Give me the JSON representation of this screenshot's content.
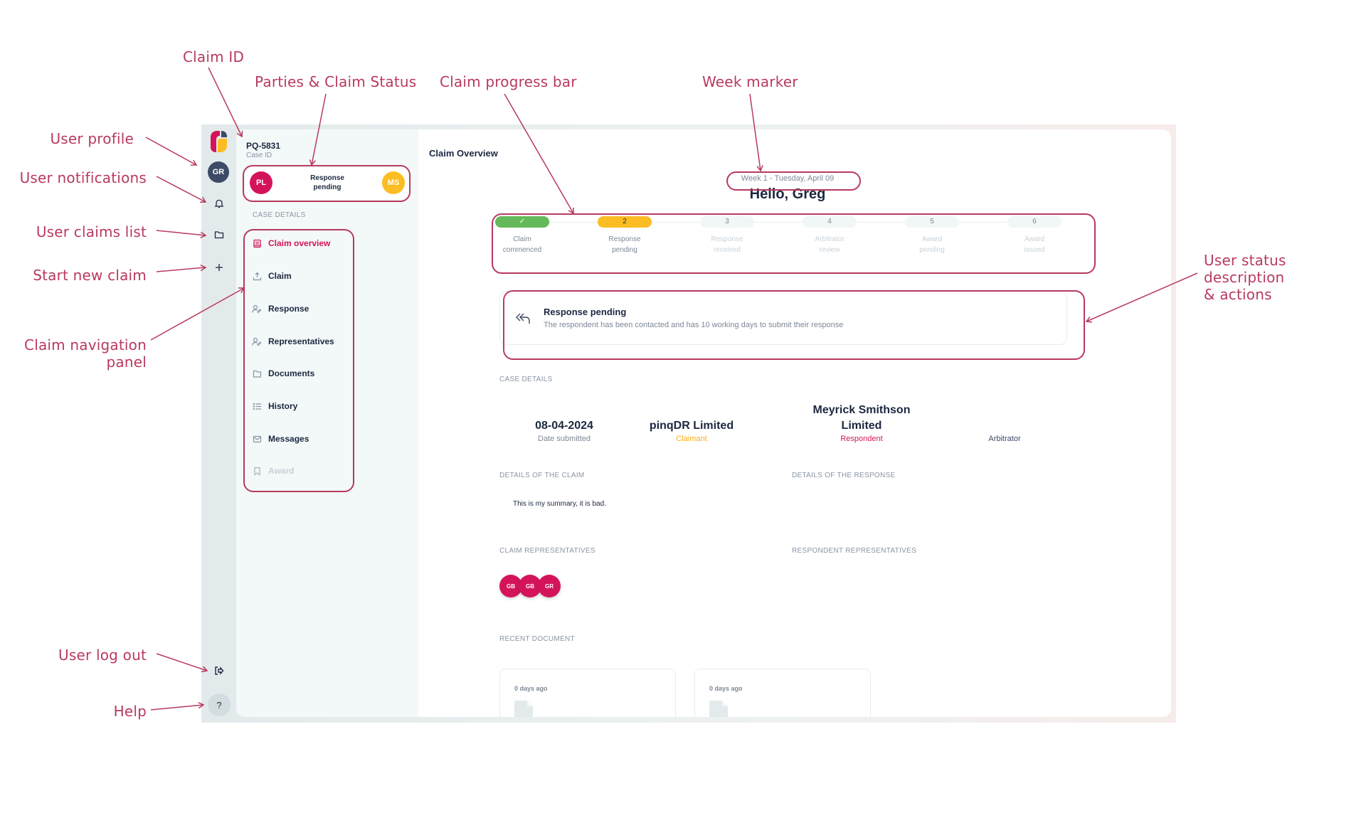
{
  "annotations": {
    "claim_id": "Claim ID",
    "parties_status": "Parties & Claim Status",
    "progress_bar": "Claim progress bar",
    "week_marker": "Week marker",
    "user_profile": "User profile",
    "user_notifications": "User notifications",
    "user_claims_list": "User claims list",
    "start_new_claim": "Start new claim",
    "claim_nav_panel_line1": "Claim navigation",
    "claim_nav_panel_line2": "panel",
    "user_status_line1": "User status",
    "user_status_line2": "description",
    "user_status_line3": "& actions",
    "user_log_out": "User log out",
    "help": "Help"
  },
  "colors": {
    "annotation": "#b83a5e",
    "brand_pink": "#d4145a",
    "brand_yellow": "#fbbd23",
    "brand_navy": "#3d4a66",
    "step_done": "#64b95a"
  },
  "rail": {
    "logo": "pinq-logo",
    "user_avatar": "GR",
    "icons": [
      "bell-icon",
      "folder-icon",
      "plus-icon",
      "logout-icon"
    ],
    "help_label": "?"
  },
  "case": {
    "id": "PQ-5831",
    "id_label": "Case ID",
    "claimant_initials": "PL",
    "respondent_initials": "MS",
    "status_line1": "Response",
    "status_line2": "pending",
    "section_label": "CASE DETAILS"
  },
  "nav": {
    "items": [
      {
        "label": "Claim overview",
        "icon": "book-icon",
        "state": "active"
      },
      {
        "label": "Claim",
        "icon": "upload-icon",
        "state": "normal"
      },
      {
        "label": "Response",
        "icon": "user-edit-icon",
        "state": "normal"
      },
      {
        "label": "Representatives",
        "icon": "user-edit-icon",
        "state": "normal"
      },
      {
        "label": "Documents",
        "icon": "folder-icon",
        "state": "normal"
      },
      {
        "label": "History",
        "icon": "list-icon",
        "state": "normal"
      },
      {
        "label": "Messages",
        "icon": "mail-icon",
        "state": "normal"
      },
      {
        "label": "Award",
        "icon": "bookmark-icon",
        "state": "disabled"
      }
    ]
  },
  "main": {
    "title": "Claim Overview",
    "week_marker": "Week 1 - Tuesday, April 09",
    "greeting": "Hello, Greg",
    "steps": [
      {
        "number": "✓",
        "line1": "Claim",
        "line2": "commenced",
        "state": "done"
      },
      {
        "number": "2",
        "line1": "Response",
        "line2": "pending",
        "state": "current"
      },
      {
        "number": "3",
        "line1": "Response",
        "line2": "received",
        "state": "upcoming"
      },
      {
        "number": "4",
        "line1": "Arbitrator",
        "line2": "review",
        "state": "upcoming"
      },
      {
        "number": "5",
        "line1": "Award",
        "line2": "pending",
        "state": "upcoming"
      },
      {
        "number": "6",
        "line1": "Award",
        "line2": "issued",
        "state": "upcoming"
      }
    ],
    "status": {
      "icon": "reply-all-icon",
      "title": "Response pending",
      "description": "The respondent has been contacted and has 10 working days to submit their response"
    },
    "case_details_label": "CASE DETAILS",
    "facts": {
      "date_value": "08-04-2024",
      "date_label": "Date submitted",
      "claimant_value": "pinqDR Limited",
      "claimant_label": "Claimant",
      "respondent_value_line1": "Meyrick Smithson",
      "respondent_value_line2": "Limited",
      "respondent_label": "Respondent",
      "arbitrator_value": "",
      "arbitrator_label": "Arbitrator"
    },
    "details_claim_label": "DETAILS OF THE CLAIM",
    "details_claim_text": "This is my summary, it is bad.",
    "details_response_label": "DETAILS OF THE RESPONSE",
    "claim_reps_label": "CLAIM REPRESENTATIVES",
    "claim_reps": [
      "GB",
      "GB",
      "GR"
    ],
    "respondent_reps_label": "RESPONDENT REPRESENTATIVES",
    "recent_document_label": "RECENT DOCUMENT",
    "documents": [
      {
        "age": "0 days ago"
      },
      {
        "age": "0 days ago"
      }
    ]
  }
}
